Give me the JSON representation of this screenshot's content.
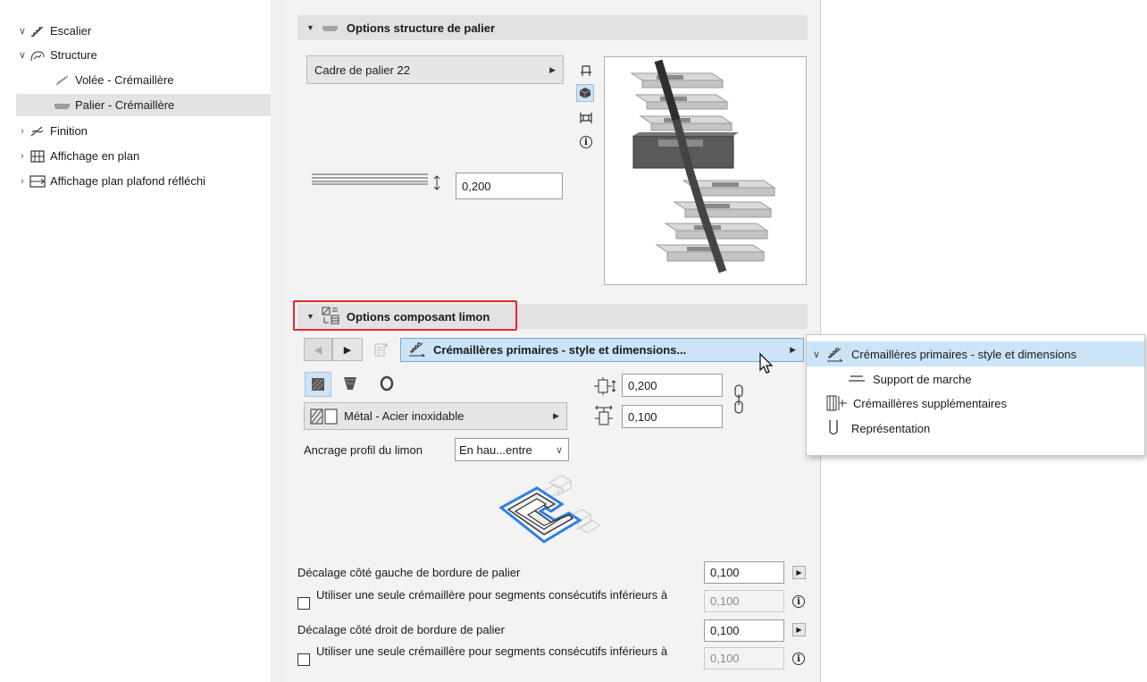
{
  "tree": {
    "items": [
      {
        "label": "Escalier",
        "icon": "stair-icon",
        "expanded": true
      },
      {
        "label": "Structure",
        "icon": "structure-icon",
        "expanded": true
      },
      {
        "label": "Volée - Crémaillère",
        "icon": "flight-stringer-icon"
      },
      {
        "label": "Palier - Crémaillère",
        "icon": "landing-stringer-icon",
        "selected": true
      },
      {
        "label": "Finition",
        "icon": "finish-icon",
        "expanded": false
      },
      {
        "label": "Affichage en plan",
        "icon": "floor-plan-icon",
        "expanded": false
      },
      {
        "label": "Affichage plan plafond réfléchi",
        "icon": "rcp-icon",
        "expanded": false
      }
    ]
  },
  "landing": {
    "title": "Options structure de palier",
    "frame_select": "Cadre de palier 22",
    "thickness": "0,200"
  },
  "stringer": {
    "title": "Options composant limon",
    "nav_dropdown": "Crémaillères primaires - style et dimensions...",
    "width": "0,200",
    "height": "0,100",
    "material": "Métal - Acier inoxidable",
    "anchor_label": "Ancrage profil du limon",
    "anchor_value": "En hau...entre",
    "left_offset_label": "Décalage côté gauche de bordure de palier",
    "left_offset_value": "0,100",
    "single_stringer_label_1": "Utiliser une seule crémaillère pour segments consécutifs inférieurs à",
    "single_stringer_value_1": "0,100",
    "right_offset_label": "Décalage côté droit de bordure de palier",
    "right_offset_value": "0,100",
    "single_stringer_label_2": "Utiliser une seule crémaillère pour segments consécutifs inférieurs à",
    "single_stringer_value_2": "0,100"
  },
  "popup": {
    "items": [
      {
        "label": "Crémaillères primaires - style et dimensions",
        "icon": "primary-stringer-icon"
      },
      {
        "label": "Support de marche",
        "icon": "tread-support-icon"
      },
      {
        "label": "Crémaillères supplémentaires",
        "icon": "additional-stringer-icon"
      },
      {
        "label": "Représentation",
        "icon": "representation-icon"
      }
    ]
  },
  "colors": {
    "highlight_red": "#e8262b",
    "popup_selected": "#cce4f7",
    "tree_selected": "#e3e3e3",
    "blue_outline": "#2f7fe6"
  }
}
